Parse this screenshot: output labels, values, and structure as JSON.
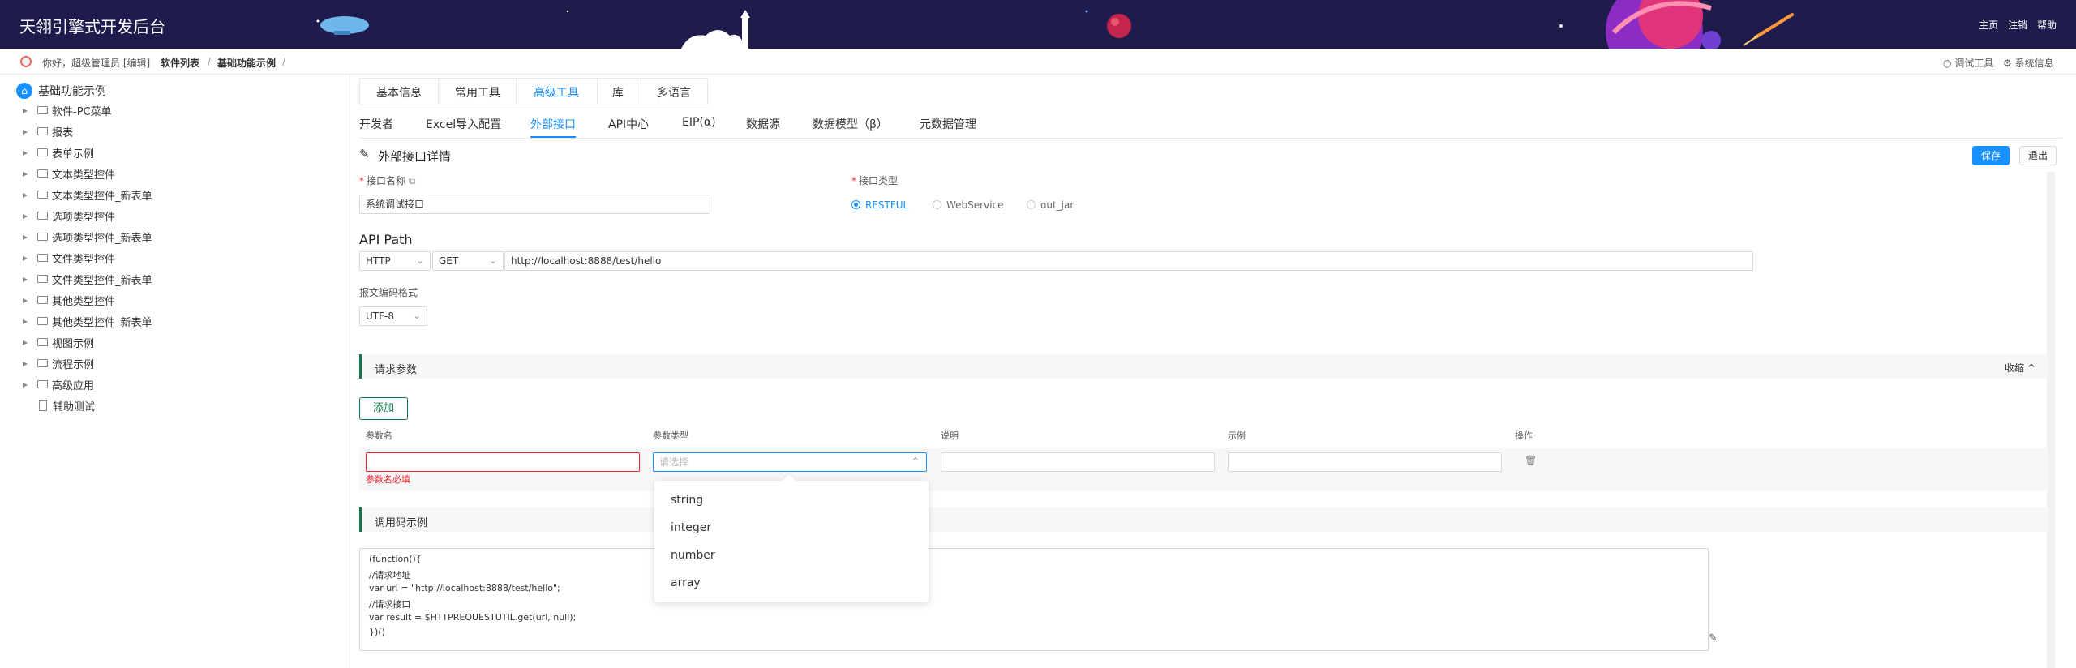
{
  "header": {
    "title": "天翎引擎式开发后台",
    "links": [
      "主页",
      "注销",
      "帮助"
    ]
  },
  "breadcrumb": {
    "greeting": "你好，超级管理员 [编辑]",
    "items": [
      "软件列表",
      "基础功能示例"
    ],
    "separator": "/",
    "right_links": [
      "调试工具",
      "系统信息"
    ]
  },
  "sidebar": {
    "root": "基础功能示例",
    "items": [
      "软件-PC菜单",
      "报表",
      "表单示例",
      "文本类型控件",
      "文本类型控件_新表单",
      "选项类型控件",
      "选项类型控件_新表单",
      "文件类型控件",
      "文件类型控件_新表单",
      "其他类型控件",
      "其他类型控件_新表单",
      "视图示例",
      "流程示例",
      "高级应用",
      "辅助测试"
    ]
  },
  "tabs_top": [
    "基本信息",
    "常用工具",
    "高级工具",
    "库",
    "多语言"
  ],
  "tabs_sub": [
    "开发者",
    "Excel导入配置",
    "外部接口",
    "API中心",
    "EIP(α)",
    "数据源",
    "数据模型（β）",
    "元数据管理"
  ],
  "form": {
    "heading": "外部接口详情",
    "save": "保存",
    "exit": "退出",
    "name_label": "接口名称",
    "name_value": "系统调试接口",
    "type_label": "接口类型",
    "type_options": [
      "RESTFUL",
      "WebService",
      "out_jar"
    ],
    "api_path_label": "API Path",
    "protocol": "HTTP",
    "method": "GET",
    "url": "http://localhost:8888/test/hello",
    "encoding_label": "报文编码格式",
    "encoding": "UTF-8"
  },
  "params": {
    "section": "请求参数",
    "collapse": "收缩",
    "add": "添加",
    "columns": [
      "参数名",
      "参数类型",
      "说明",
      "示例",
      "操作"
    ],
    "type_placeholder": "请选择",
    "error": "参数名必填",
    "type_options": [
      "string",
      "integer",
      "number",
      "array"
    ]
  },
  "code": {
    "section": "调用码示例",
    "lines": [
      "(function(){",
      "//请求地址",
      "var url = \"http://localhost:8888/test/hello\";",
      "//请求接口",
      "var result = $HTTPREQUESTUTIL.get(url, null);",
      "})()"
    ]
  },
  "colors": {
    "header_bg": "#1f1b4d",
    "accent": "#1890ff",
    "section_bar": "#0e7a47",
    "error": "#f5222d"
  }
}
